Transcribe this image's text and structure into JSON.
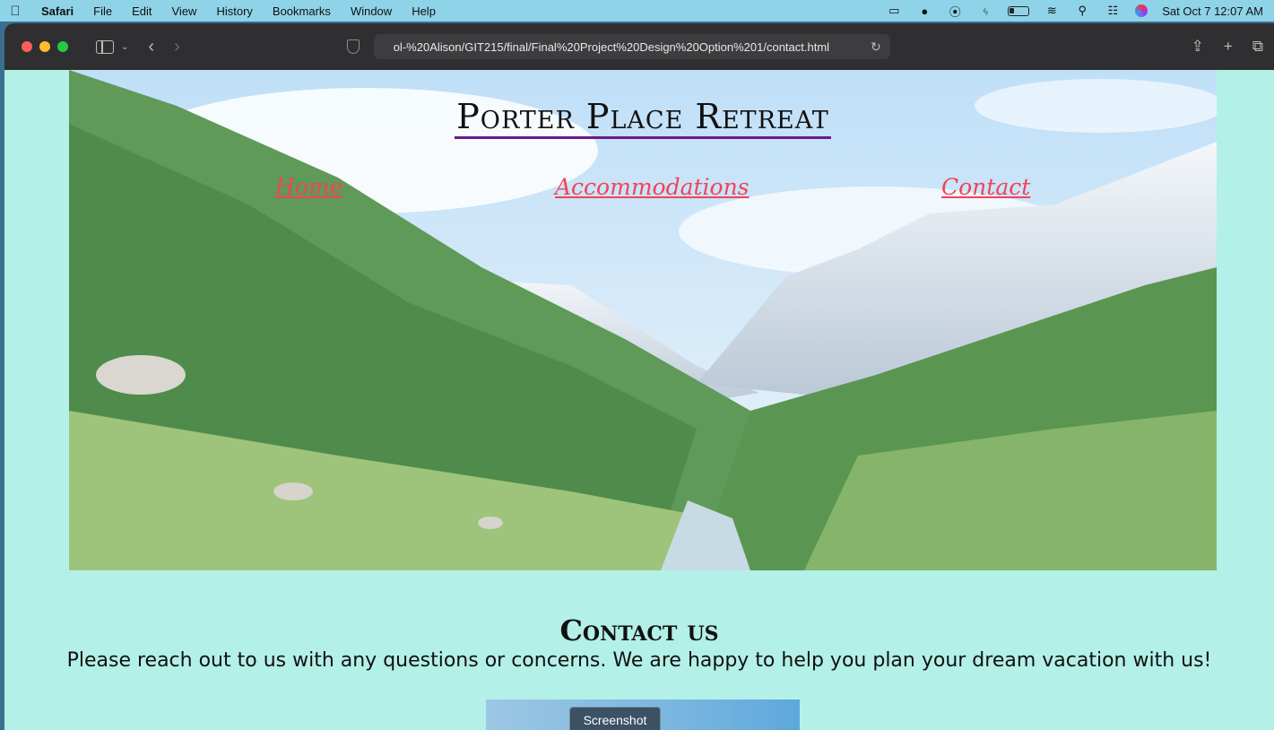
{
  "menubar": {
    "apple_icon": "apple-logo-icon",
    "app_name": "Safari",
    "items": [
      "File",
      "Edit",
      "View",
      "History",
      "Bookmarks",
      "Window",
      "Help"
    ],
    "clock": "Sat Oct 7  12:07 AM"
  },
  "browser": {
    "url": "ol-%20Alison/GIT215/final/Final%20Project%20Design%20Option%201/contact.html"
  },
  "site": {
    "title": "Porter Place Retreat",
    "nav": {
      "home": "Home",
      "accommodations": "Accommodations",
      "contact": "Contact"
    },
    "contact_heading": "Contact us",
    "contact_text": "Please reach out to us with any questions or concerns. We are happy to help you plan your dream vacation with us!"
  },
  "tooltip": {
    "label": "Screenshot"
  },
  "colors": {
    "page_background": "#b3f0e7",
    "nav_link": "#f2435a",
    "title_underline": "#6a1a8a",
    "menubar": "#8fd3e8",
    "toolbar": "#2f2f31"
  }
}
